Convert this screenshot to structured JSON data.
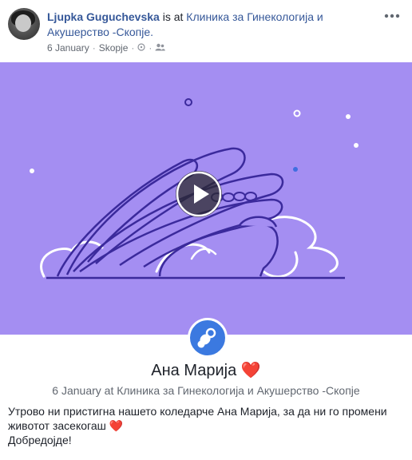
{
  "post": {
    "author": "Ljupka Guguchevska",
    "action": " is at ",
    "place": "Клиника за Гинекологија и Акушерство -Скопје.",
    "date": "6 January",
    "location": "Skopje",
    "privacy_icon": "friends-icon"
  },
  "media": {
    "type": "video",
    "background_color": "#a48ef2",
    "play_icon": "play-icon"
  },
  "life_event": {
    "icon": "pacifier-icon",
    "icon_color": "#3b79e0",
    "title": "Ана Марија",
    "title_emoji": "❤️",
    "subtitle": "6 January at Клиника за Гинекологија и Акушерство -Скопје"
  },
  "text": {
    "line1": "Утрово ни пристигна нашето коледарче Ана Марија, за да ни го промени",
    "line2": "животот засекогаш",
    "line2_emoji": "❤️",
    "line3": "Добредојде!"
  }
}
